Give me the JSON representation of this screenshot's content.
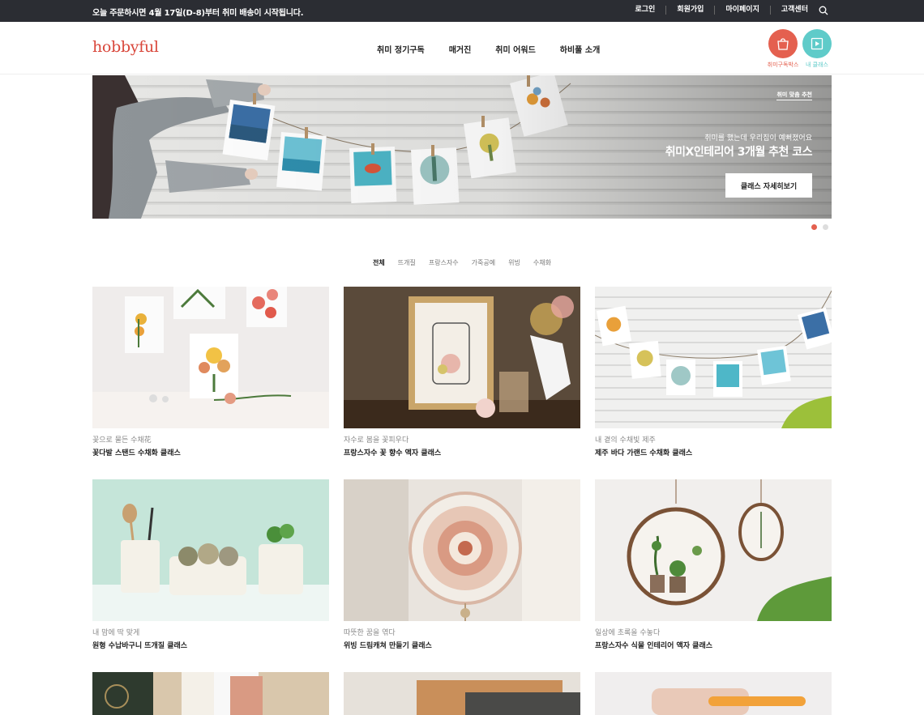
{
  "topbar": {
    "notice": "오늘 주문하시면 4월 17일(D-8)부터 취미 배송이 시작됩니다.",
    "links": [
      "로그인",
      "회원가입",
      "마이페이지",
      "고객센터"
    ],
    "search_icon": "search-icon"
  },
  "header": {
    "logo": "hobbyful",
    "menu": [
      "취미 정기구독",
      "매거진",
      "취미 어워드",
      "하비풀 소개"
    ],
    "quick": [
      {
        "label": "취미구독박스",
        "icon": "shopping-bag-icon",
        "color": "#e4604f"
      },
      {
        "label": "내 클래스",
        "icon": "play-icon",
        "color": "#5fcbc9"
      }
    ]
  },
  "hero": {
    "tag": "취미 맞춤 추천",
    "subtitle": "취미를 했는데 우리집이 예뻐졌어요",
    "title": "취미X인테리어 3개월 추천 코스",
    "cta": "클래스 자세히보기",
    "slide_count": 2,
    "active_slide": 1
  },
  "categories": {
    "items": [
      "전체",
      "뜨개질",
      "프랑스자수",
      "가죽공예",
      "위빙",
      "수채화"
    ],
    "active": 0
  },
  "cards": [
    {
      "subtitle": "꽃으로 물든 수채花",
      "title": "꽃다발 스탠드 수채화 클래스"
    },
    {
      "subtitle": "자수로 봄을 꽃피우다",
      "title": "프랑스자수 꽃 향수 액자 클래스"
    },
    {
      "subtitle": "내 곁의 수채빛 제주",
      "title": "제주 바다 가랜드 수채화 클래스"
    },
    {
      "subtitle": "내 맘에 딱 맞게",
      "title": "원형 수납바구니 뜨개질 클래스"
    },
    {
      "subtitle": "따뜻한 꿈을 엮다",
      "title": "위빙 드림캐쳐 만들기 클래스"
    },
    {
      "subtitle": "일상에 초록을 수놓다",
      "title": "프랑스자수 식물 인테리어 액자 클래스"
    }
  ],
  "colors": {
    "accent": "#e4604f",
    "teal": "#5fcbc9",
    "topbar": "#2b2d33"
  }
}
